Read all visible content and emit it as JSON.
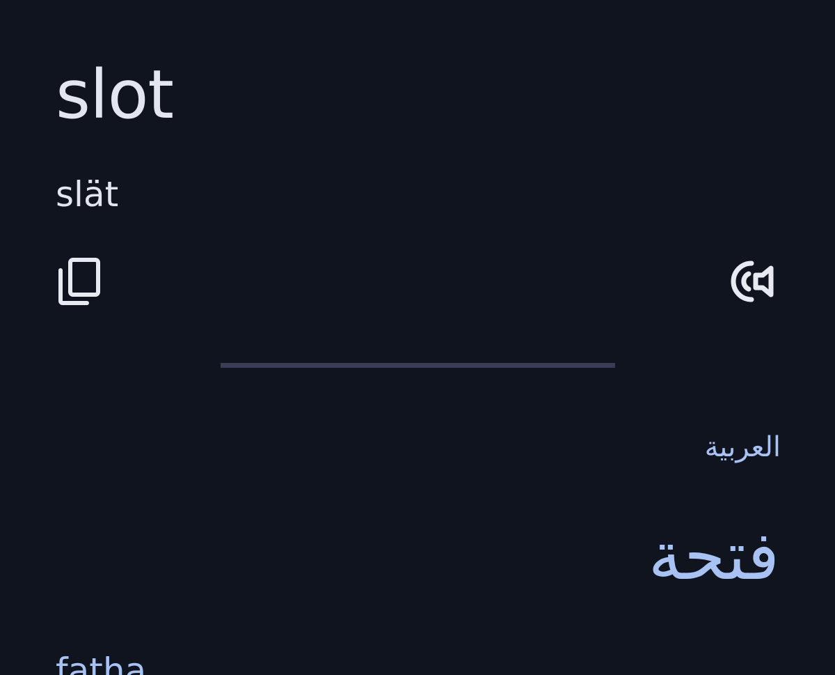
{
  "source": {
    "word": "slot",
    "pronunciation": "slät"
  },
  "actions": {
    "copy_icon": "copy-icon",
    "listen_icon": "speaker-icon"
  },
  "target": {
    "language": "العربية",
    "translation": "فتحة",
    "transliteration": "fatha"
  },
  "colors": {
    "background": "#10141e",
    "primary_text": "#e3e5f0",
    "accent_text": "#a9c2f4",
    "divider": "#3a3c57"
  }
}
